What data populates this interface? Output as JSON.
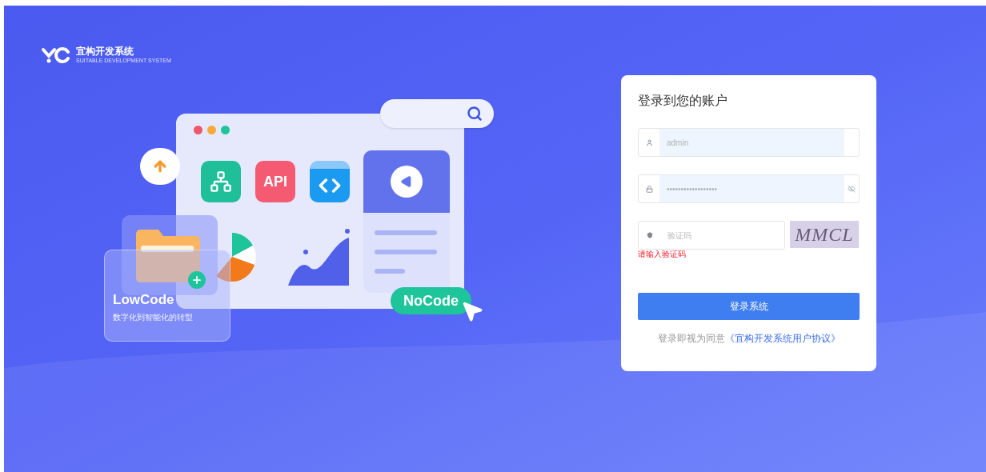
{
  "logo": {
    "name": "宜构开发系统",
    "tagline": "SUITABLE DEVELOPMENT SYSTEM"
  },
  "illustration": {
    "api_label": "API",
    "lowcode_title": "LowCode",
    "lowcode_caption": "数字化到智能化的转型",
    "nocode_label": "NoCode"
  },
  "login": {
    "title": "登录到您的账户",
    "fields": [
      {
        "kind": "text",
        "value": "admin"
      },
      {
        "kind": "password",
        "value": "••••••••••••••••••"
      }
    ],
    "captcha": {
      "placeholder": "验证码",
      "error": "请输入验证码",
      "image_text": "MMCL"
    },
    "submit": "登录系统",
    "agreement": {
      "text": "登录即视为同意",
      "link": "《宜构开发系统用户协议》"
    }
  }
}
